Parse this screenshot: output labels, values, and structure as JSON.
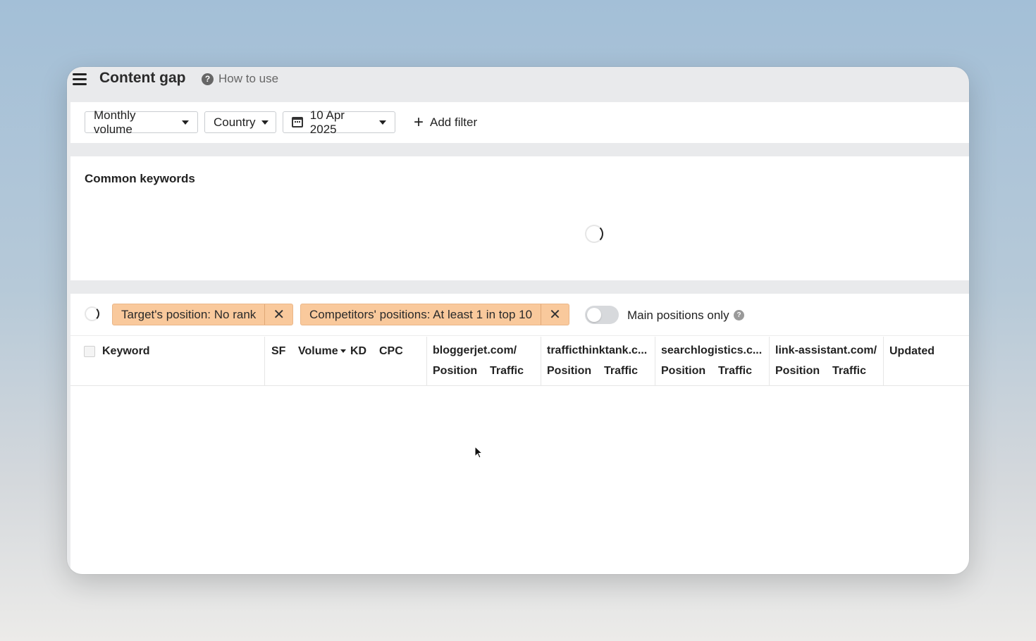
{
  "header": {
    "title": "Content gap",
    "help_label": "How to use"
  },
  "filters": {
    "volume_label": "Monthly volume",
    "country_label": "Country",
    "date_label": "10 Apr 2025",
    "add_filter_label": "Add filter"
  },
  "common_keywords": {
    "title": "Common keywords"
  },
  "tags": [
    {
      "label": "Target's position: No rank"
    },
    {
      "label": "Competitors' positions: At least 1 in top 10"
    }
  ],
  "toggle": {
    "label": "Main positions only",
    "on": false
  },
  "table": {
    "columns": {
      "keyword": "Keyword",
      "sf": "SF",
      "volume": "Volume",
      "kd": "KD",
      "cpc": "CPC",
      "updated": "Updated"
    },
    "competitors": [
      {
        "domain": "bloggerjet.com/",
        "position": "Position",
        "traffic": "Traffic"
      },
      {
        "domain": "trafficthinktank.c...",
        "position": "Position",
        "traffic": "Traffic"
      },
      {
        "domain": "searchlogistics.c...",
        "position": "Position",
        "traffic": "Traffic"
      },
      {
        "domain": "link-assistant.com/",
        "position": "Position",
        "traffic": "Traffic"
      }
    ],
    "rows": []
  },
  "icons": {
    "menu": "hamburger-menu-icon",
    "help": "question-circle-icon",
    "calendar": "calendar-icon",
    "add": "plus-icon",
    "remove": "close-x-icon",
    "loading": "spinner-icon"
  }
}
